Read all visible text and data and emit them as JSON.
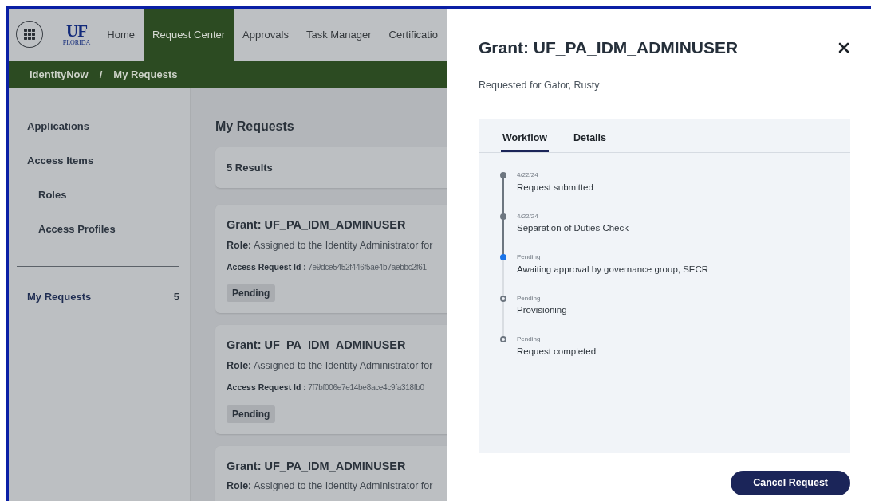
{
  "logo": {
    "mark": "UF",
    "name": "FLORIDA"
  },
  "nav": [
    {
      "label": "Home",
      "selected": false
    },
    {
      "label": "Request Center",
      "selected": true
    },
    {
      "label": "Approvals",
      "selected": false
    },
    {
      "label": "Task Manager",
      "selected": false
    },
    {
      "label": "Certificatio",
      "selected": false
    }
  ],
  "breadcrumb": {
    "items": [
      "IdentityNow",
      "My Requests"
    ],
    "separator": "/"
  },
  "sidebar": {
    "items": [
      {
        "label": "Applications"
      },
      {
        "label": "Access Items",
        "children": [
          {
            "label": "Roles"
          },
          {
            "label": "Access Profiles"
          }
        ]
      }
    ],
    "footer_item": {
      "label": "My Requests",
      "count": "5"
    }
  },
  "main": {
    "title": "My Requests",
    "results": "5 Results",
    "cards": [
      {
        "title": "Grant: UF_PA_IDM_ADMINUSER",
        "role_label": "Role:",
        "role": "Assigned to the Identity Administrator for",
        "id_label": "Access Request Id :",
        "id": "7e9dce5452f446f5ae4b7aebbc2f61",
        "status": "Pending"
      },
      {
        "title": "Grant: UF_PA_IDM_ADMINUSER",
        "role_label": "Role:",
        "role": "Assigned to the Identity Administrator for",
        "id_label": "Access Request Id :",
        "id": "7f7bf006e7e14be8ace4c9fa318fb0",
        "status": "Pending"
      },
      {
        "title": "Grant: UF_PA_IDM_ADMINUSER",
        "role_label": "Role:",
        "role": "Assigned to the Identity Administrator for"
      }
    ]
  },
  "drawer": {
    "title": "Grant: UF_PA_IDM_ADMINUSER",
    "subtitle": "Requested for Gator, Rusty",
    "tabs": [
      {
        "label": "Workflow",
        "selected": true
      },
      {
        "label": "Details",
        "selected": false
      }
    ],
    "steps": [
      {
        "date": "4/22/24",
        "label": "Request submitted",
        "kind": "complete"
      },
      {
        "date": "4/22/24",
        "label": "Separation of Duties Check",
        "kind": "complete"
      },
      {
        "date": "Pending",
        "label": "Awaiting approval by governance group, SECR",
        "kind": "current"
      },
      {
        "date": "Pending",
        "label": "Provisioning",
        "kind": "pending"
      },
      {
        "date": "Pending",
        "label": "Request completed",
        "kind": "pending"
      }
    ],
    "button": "Cancel Request"
  }
}
